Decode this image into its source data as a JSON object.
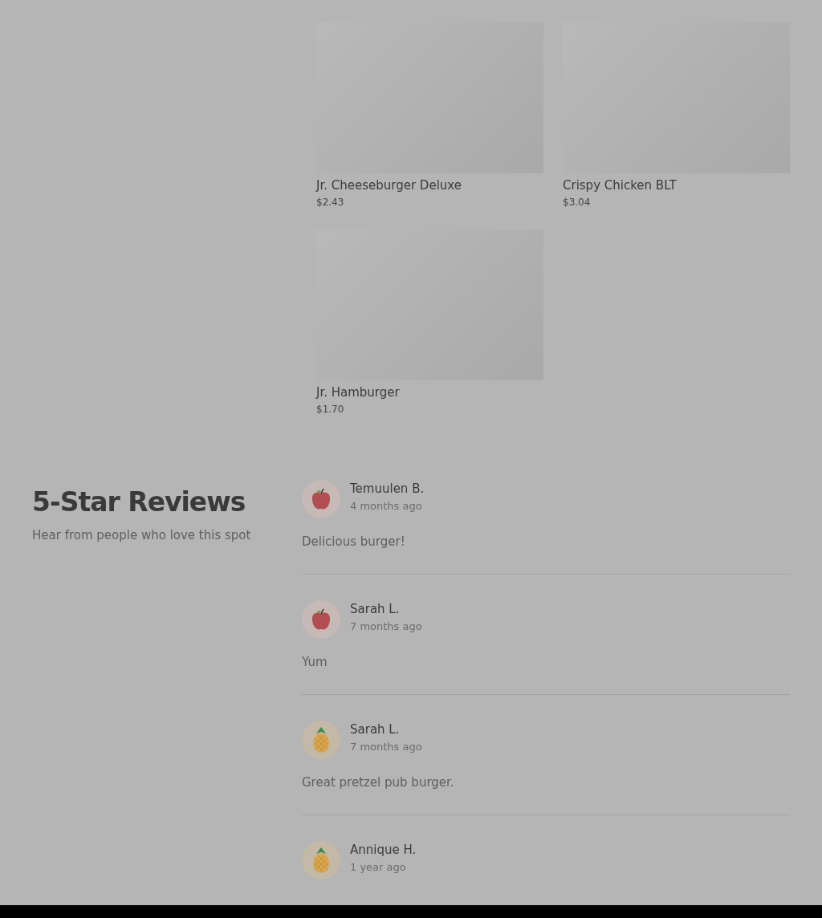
{
  "menu_items": [
    {
      "name": "Jr. Cheeseburger Deluxe",
      "price": "$2.43"
    },
    {
      "name": "Crispy Chicken BLT",
      "price": "$3.04"
    },
    {
      "name": "Jr. Hamburger",
      "price": "$1.70"
    }
  ],
  "reviews_section": {
    "title": "5-Star Reviews",
    "subtitle": "Hear from people who love this spot"
  },
  "reviews": [
    {
      "author": "Temuulen B.",
      "time": "4 months ago",
      "text": "Delicious burger!",
      "kind": "apple"
    },
    {
      "author": "Sarah L.",
      "time": "7 months ago",
      "text": "Yum",
      "kind": "apple"
    },
    {
      "author": "Sarah L.",
      "time": "7 months ago",
      "text": "Great pretzel pub burger.",
      "kind": "pineapple"
    },
    {
      "author": "Annique H.",
      "time": "1 year ago",
      "kind": "pineapple"
    }
  ]
}
